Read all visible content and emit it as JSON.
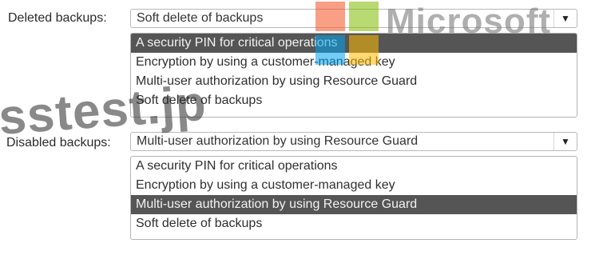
{
  "deleted_backups": {
    "label": "Deleted backups:",
    "selected_value": "Soft delete of backups",
    "options": [
      "A security PIN for critical operations",
      "Encryption by using a customer-managed key",
      "Multi-user authorization by using Resource Guard",
      "Soft delete of backups"
    ],
    "highlighted_index": 0
  },
  "disabled_backups": {
    "label": "Disabled backups:",
    "selected_value": "Multi-user authorization by using Resource Guard",
    "options": [
      "A security PIN for critical operations",
      "Encryption by using a customer-managed key",
      "Multi-user authorization by using Resource Guard",
      "Soft delete of backups"
    ],
    "highlighted_index": 2
  },
  "watermark": {
    "logo_text": "Microsoft",
    "site_text": "sstest.jp",
    "logo_colors": [
      "#f25022",
      "#7fba00",
      "#00a4ef",
      "#ffb900"
    ]
  },
  "icons": {
    "dropdown_arrow": "chevron-down-icon"
  }
}
